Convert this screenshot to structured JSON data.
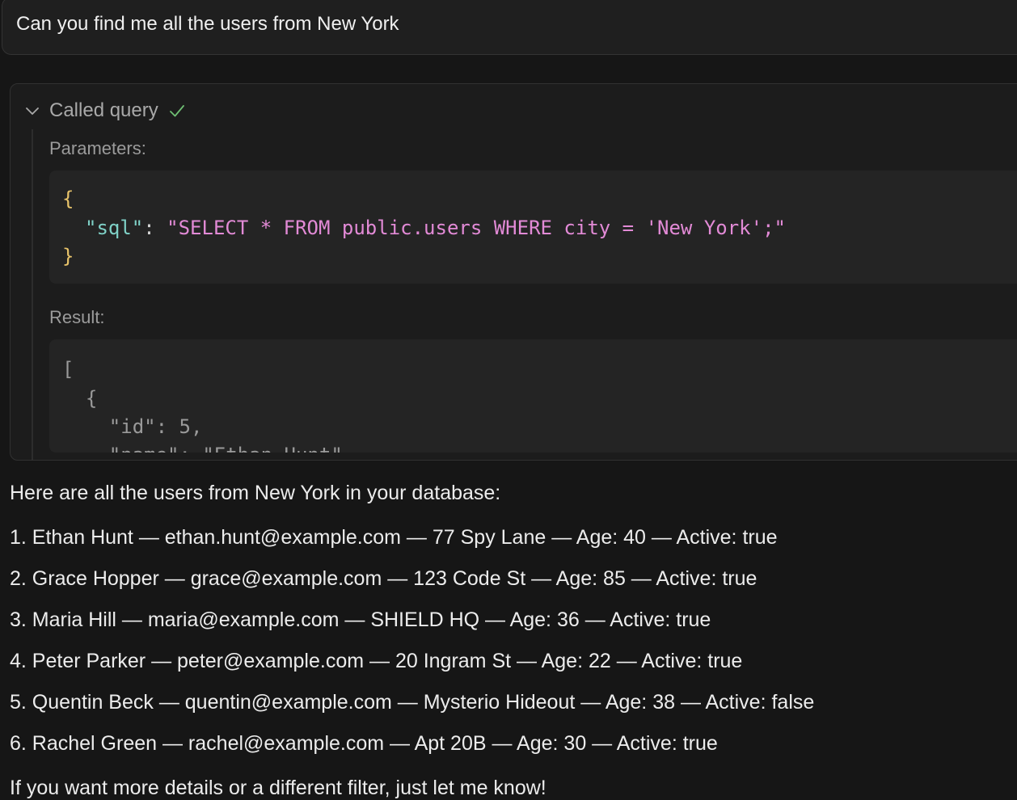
{
  "user_message": "Can you find me all the users from New York",
  "tool_call": {
    "title": "Called query",
    "status_icon": "check-icon",
    "parameters_label": "Parameters:",
    "params_code": {
      "open": "{",
      "key": "\"sql\"",
      "colon": ": ",
      "value": "\"SELECT * FROM public.users WHERE city = 'New York';\"",
      "close": "}"
    },
    "result_label": "Result:",
    "result_code": {
      "line1": "[",
      "line2": "  {",
      "line3": "    \"id\": 5,",
      "line4": "    \"name\": \"Ethan Hunt\","
    }
  },
  "assistant": {
    "intro": "Here are all the users from New York in your database:",
    "users": [
      "1. Ethan Hunt — ethan.hunt@example.com — 77 Spy Lane — Age: 40 — Active: true",
      "2. Grace Hopper — grace@example.com — 123 Code St — Age: 85 — Active: true",
      "3. Maria Hill — maria@example.com — SHIELD HQ — Age: 36 — Active: true",
      "4. Peter Parker — peter@example.com — 20 Ingram St — Age: 22 — Active: true",
      "5. Quentin Beck — quentin@example.com — Mysterio Hideout — Age: 38 — Active: false",
      "6. Rachel Green — rachel@example.com — Apt 20B — Age: 30 — Active: true"
    ],
    "outro": "If you want more details or a different filter, just let me know!"
  },
  "colors": {
    "background": "#161616",
    "brace": "#e9c46a",
    "json_key": "#7fd1c7",
    "string": "#e28ad6",
    "check": "#6fbf73"
  }
}
